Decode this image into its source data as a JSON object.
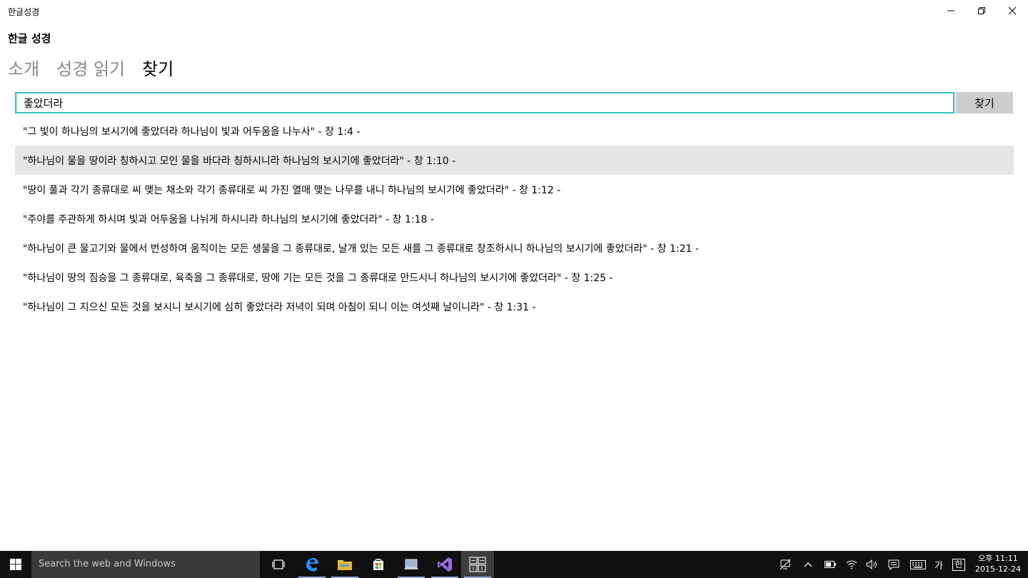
{
  "window": {
    "title": "한글성경",
    "minimize_icon": "minimize-icon",
    "restore_icon": "restore-icon",
    "close_icon": "close-icon"
  },
  "app": {
    "title": "한글 성경"
  },
  "pivot": {
    "tabs": [
      {
        "label": "소개"
      },
      {
        "label": "성경 읽기"
      },
      {
        "label": "찾기"
      }
    ],
    "active": "찾기"
  },
  "search": {
    "value": "좋았더라",
    "button_label": "찾기"
  },
  "results": [
    {
      "text": "\"그 빛이 하나님의 보시기에 좋았더라 하나님이 빛과 어두움을 나누사\" - 창 1:4 -"
    },
    {
      "text": "\"하나님이 물을 땅이라 칭하시고 모인 물을 바다라 칭하시니라 하나님의 보시기에 좋았더라\" - 창 1:10 -"
    },
    {
      "text": "\"땅이 풀과 각기 종류대로 씨 맺는 채소와 각기 종류대로 씨 가진 열매 맺는 나무를 내니 하나님의 보시기에 좋았더라\" - 창 1:12 -"
    },
    {
      "text": "\"주야를 주관하게 하시며 빛과 어두움을 나뉘게 하시니라 하나님의 보시기에 좋았더라\" - 창 1:18 -"
    },
    {
      "text": "\"하나님이 큰 물고기와 물에서 번성하여 움직이는 모든 생물을 그 종류대로, 날개 있는 모든 새를 그 종류대로 창조하시니 하나님의 보시기에 좋았더라\" - 창 1:21 -"
    },
    {
      "text": "\"하나님이 땅의 짐승을 그 종류대로, 육축을 그 종류대로, 땅에 기는 모든 것을 그 종류대로 만드시니 하나님의 보시기에 좋았더라\" - 창 1:25 -"
    },
    {
      "text": "\"하나님이 그 지으신 모든 것을 보시니 보시기에 심히 좋았더라 저녁이 되며 아침이 되니 이는 여섯째 날이니라\" - 창 1:31 -"
    }
  ],
  "selected_result_index": 1,
  "colors": {
    "search_border": "#2ec4c4",
    "selected_row": "#e6e6e6",
    "taskbar": "#101010"
  },
  "taskbar": {
    "search_placeholder": "Search the web and Windows",
    "apps": [
      {
        "icon": "task-view-icon"
      },
      {
        "icon": "edge-icon"
      },
      {
        "icon": "file-explorer-icon"
      },
      {
        "icon": "store-icon"
      },
      {
        "icon": "app-icon"
      },
      {
        "icon": "visual-studio-icon"
      },
      {
        "icon": "korean-bible-app-icon"
      }
    ],
    "tray": {
      "ime_label_1": "가",
      "ime_label_2": "한"
    },
    "clock": {
      "time": "오후 11:11",
      "date": "2015-12-24"
    }
  }
}
